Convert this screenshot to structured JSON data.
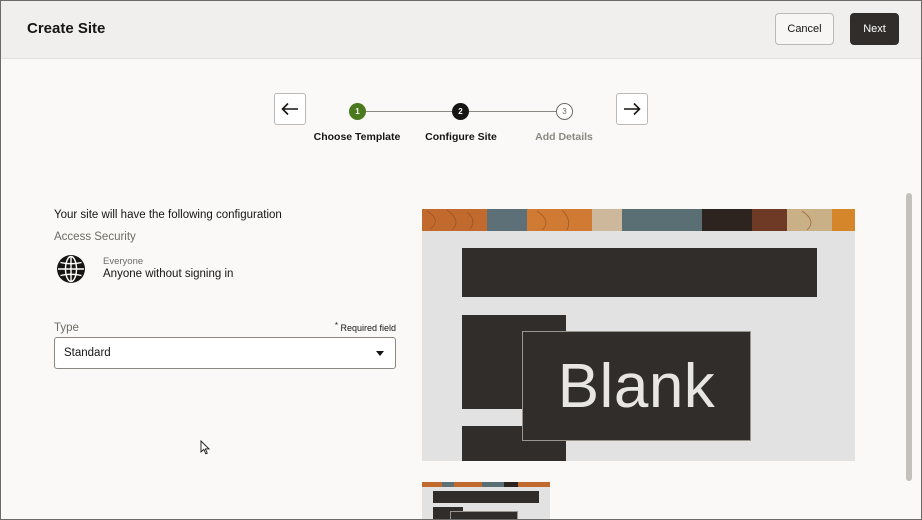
{
  "header": {
    "title": "Create Site",
    "cancel_label": "Cancel",
    "next_label": "Next"
  },
  "stepper": {
    "steps": [
      {
        "number": "1",
        "label": "Choose Template",
        "state": "completed"
      },
      {
        "number": "2",
        "label": "Configure Site",
        "state": "current"
      },
      {
        "number": "3",
        "label": "Add Details",
        "state": "pending"
      }
    ],
    "back_icon": "arrow-left-icon",
    "forward_icon": "arrow-right-icon"
  },
  "config": {
    "intro": "Your site will have the following configuration",
    "access_heading": "Access Security",
    "access_icon": "globe-icon",
    "access_small": "Everyone",
    "access_value": "Anyone without signing in",
    "type_label": "Type",
    "required_star": "*",
    "required_text": "Required field",
    "type_value": "Standard"
  },
  "preview": {
    "label": "Blank"
  },
  "colors": {
    "primary_button": "#312d2a",
    "step_completed": "#4b7a1e",
    "step_current": "#161513",
    "header_bg": "#f1efed",
    "page_bg": "#faf9f7"
  }
}
